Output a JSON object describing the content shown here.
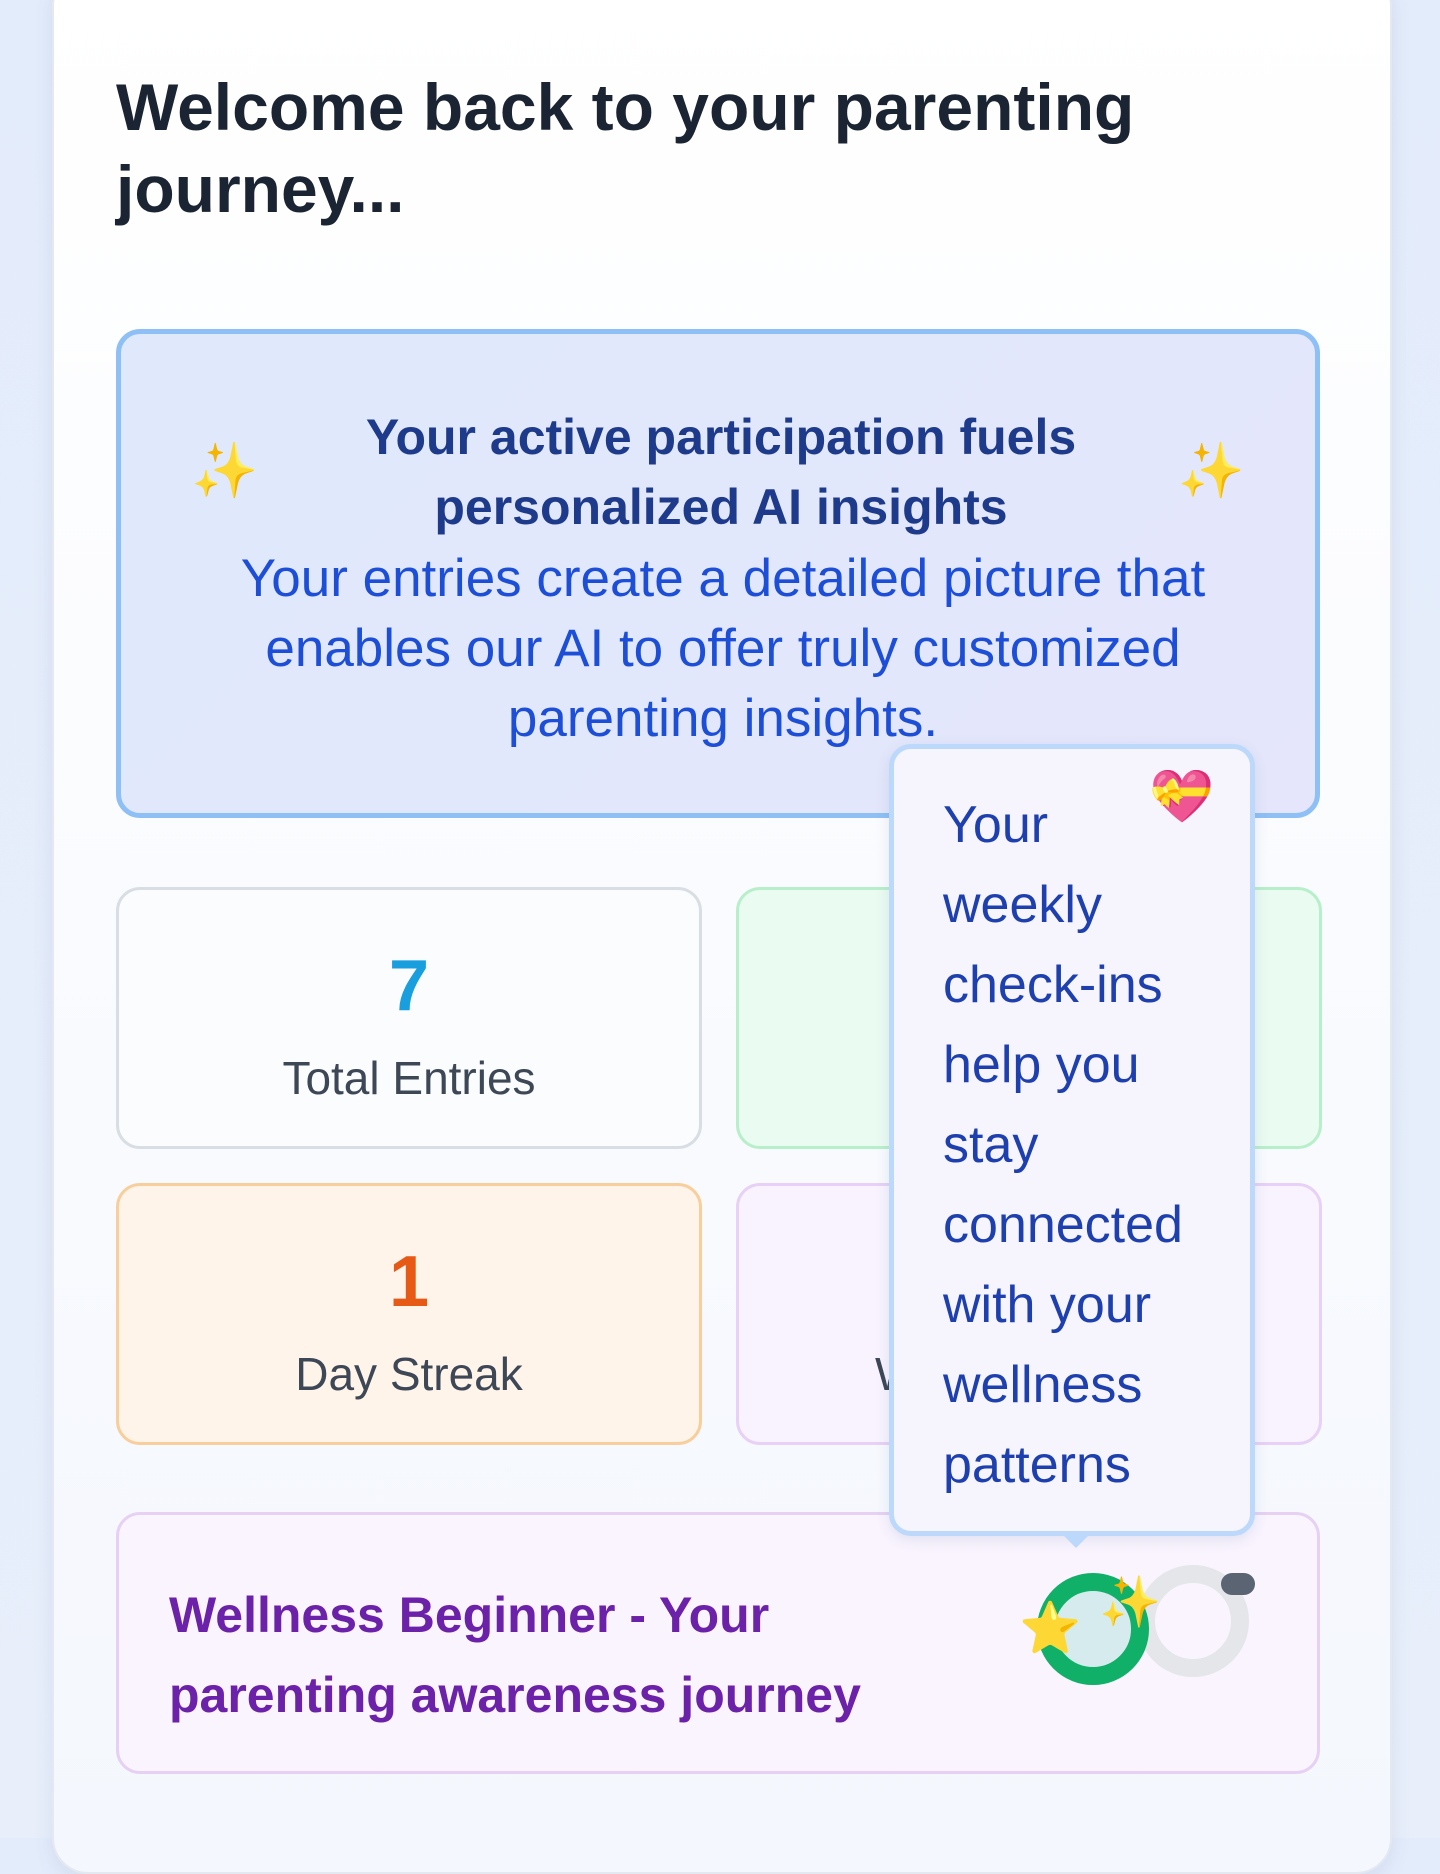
{
  "header": {
    "title": "Welcome back to your parenting journey..."
  },
  "banner": {
    "heading": "Your active participation fuels personalized AI insights",
    "body": "Your entries create a detailed picture that enables our AI to offer truly customized parenting insights.",
    "left_icon": "✨",
    "right_icon": "✨"
  },
  "stats": {
    "total_entries": {
      "value": "7",
      "label": "Total Entries"
    },
    "day_streak": {
      "value": "1",
      "label": "Day Streak"
    },
    "fourth_label_partial": "W"
  },
  "level": {
    "text": "Wellness Beginner - Your parenting awareness journey",
    "star_icon": "⭐",
    "sparkle_icon": "✨"
  },
  "tooltip": {
    "text": "Your weekly check-ins help you stay connected with your wellness patterns",
    "icon": "💝"
  },
  "colors": {
    "accent_blue": "#199ede",
    "streak_orange": "#e65a15",
    "level_purple": "#6b21a8",
    "progress_green": "#10b068"
  }
}
